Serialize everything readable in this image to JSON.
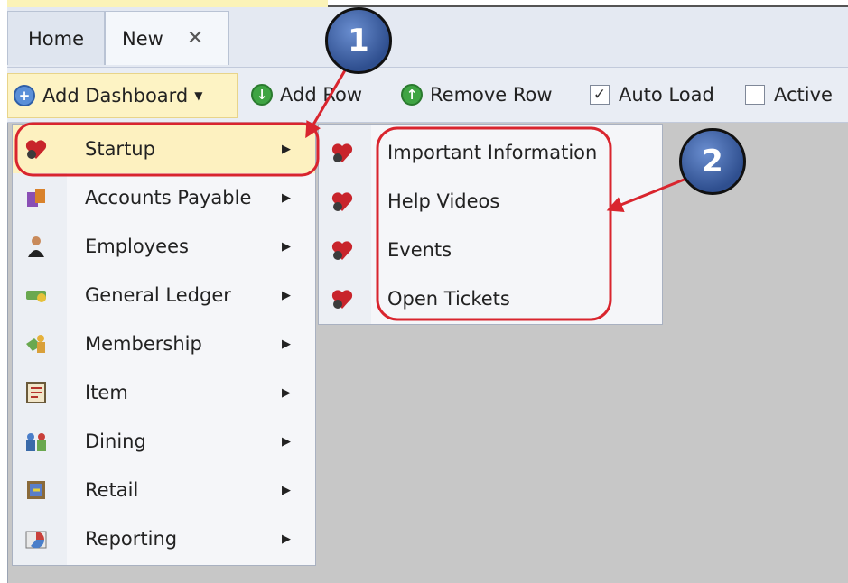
{
  "tabs": [
    {
      "label": "Home"
    },
    {
      "label": "New",
      "close": "✕"
    }
  ],
  "toolbar": {
    "add_dashboard": "Add Dashboard",
    "add_row": "Add Row",
    "remove_row": "Remove Row",
    "auto_load": "Auto Load",
    "auto_load_checked": true,
    "active": "Active",
    "active_checked": false
  },
  "menu": {
    "items": [
      {
        "label": "Startup",
        "icon": "startup-icon"
      },
      {
        "label": "Accounts Payable",
        "icon": "accounts-payable-icon"
      },
      {
        "label": "Employees",
        "icon": "employees-icon"
      },
      {
        "label": "General Ledger",
        "icon": "general-ledger-icon"
      },
      {
        "label": "Membership",
        "icon": "membership-icon"
      },
      {
        "label": "Item",
        "icon": "item-icon"
      },
      {
        "label": "Dining",
        "icon": "dining-icon"
      },
      {
        "label": "Retail",
        "icon": "retail-icon"
      },
      {
        "label": "Reporting",
        "icon": "reporting-icon"
      }
    ]
  },
  "submenu": {
    "items": [
      {
        "label": "Important Information",
        "icon": "startup-icon"
      },
      {
        "label": "Help Videos",
        "icon": "startup-icon"
      },
      {
        "label": "Events",
        "icon": "startup-icon"
      },
      {
        "label": "Open Tickets",
        "icon": "startup-icon"
      }
    ]
  },
  "callouts": [
    {
      "label": "1"
    },
    {
      "label": "2"
    }
  ],
  "colors": {
    "annotation_red": "#d9252e",
    "highlight": "#fdf1c0",
    "callout_blue": "#3f62a8"
  }
}
